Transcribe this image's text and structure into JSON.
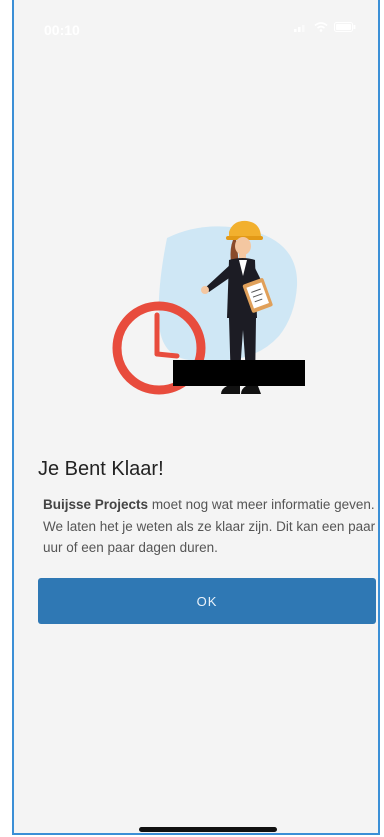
{
  "status_bar": {
    "time": "00:10"
  },
  "dialog": {
    "title": "Je Bent Klaar!",
    "company": "Buijsse Projects",
    "message": "moet nog wat meer informatie geven. We laten het je weten als ze klaar zijn. Dit kan een paar uur of een paar dagen duren.",
    "ok_label": "OK"
  },
  "colors": {
    "accent": "#2f78b4",
    "clock": "#e84c3d",
    "helmet": "#f2b02e",
    "blob": "#cfe7f5"
  },
  "icons": {
    "illustration": "worker-with-clock-illustration",
    "status": [
      "signal-icon",
      "wifi-icon",
      "battery-icon"
    ]
  }
}
